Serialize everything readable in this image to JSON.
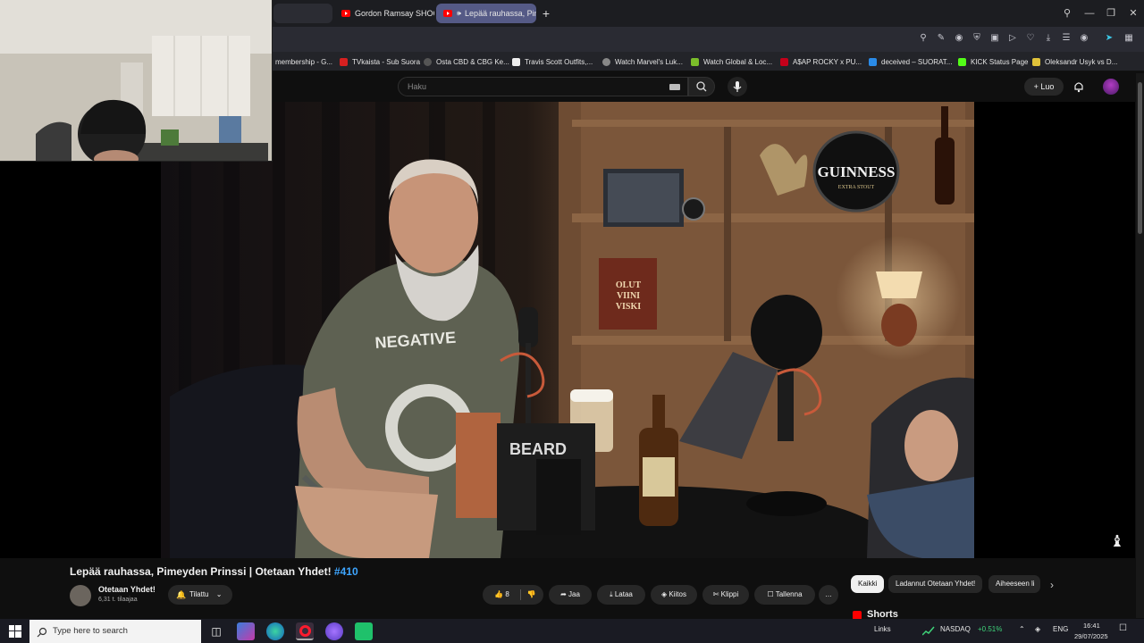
{
  "browser": {
    "tabs": [
      {
        "label": "Gordon Ramsay SHOCKE",
        "active": false
      },
      {
        "label": "Lepää rauhassa, Pime",
        "active": true
      }
    ],
    "new_tab": "+",
    "bookmarks": [
      {
        "label": "membership - G...",
        "color": "#2c2c2c"
      },
      {
        "label": "TVkaista - Sub Suora",
        "color": "#d62020"
      },
      {
        "label": "Osta CBD & CBG Ke...",
        "color": "#555555"
      },
      {
        "label": "Travis Scott Outfits,...",
        "color": "#eeeeee"
      },
      {
        "label": "Watch Marvel's Luk...",
        "color": "#888888"
      },
      {
        "label": "Watch Global & Loc...",
        "color": "#7bbd2a"
      },
      {
        "label": "A$AP ROCKY x PU...",
        "color": "#c4001a"
      },
      {
        "label": "deceived – SUORAT...",
        "color": "#2a8be8"
      },
      {
        "label": "KICK Status Page",
        "color": "#53fc18"
      },
      {
        "label": "Oleksandr Usyk vs D...",
        "color": "#e0c23a"
      }
    ]
  },
  "masthead": {
    "search_placeholder": "Haku",
    "create_label": "Luo"
  },
  "video": {
    "title": "Lepää rauhassa, Pimeyden Prinssi | Otetaan Yhdet!",
    "hashtag": "#410",
    "channel_name": "Otetaan Yhdet!",
    "subscribers": "6,31 t. tilaajaa",
    "subscribed_label": "Tilattu",
    "likes": "8",
    "share_label": "Jaa",
    "download_label": "Lataa",
    "thanks_label": "Kiitos",
    "clip_label": "Klippi",
    "save_label": "Tallenna",
    "more_label": "…"
  },
  "scene_text": {
    "shirt": "NEGATIVE",
    "guinness": "GUINNESS",
    "guinness_sub": "EXTRA STOUT",
    "book": [
      "OLUT",
      "VIINI",
      "VISKI"
    ],
    "box": "BEARD"
  },
  "sidebar": {
    "chips": [
      "Kaikki",
      "Ladannut Otetaan Yhdet!",
      "Aiheeseen li"
    ],
    "shorts_label": "Shorts"
  },
  "taskbar": {
    "search_placeholder": "Type here to search",
    "nasdaq_label": "NASDAQ",
    "nasdaq_change": "+0.51%",
    "links_label": "Links",
    "language": "ENG",
    "time": "16:41",
    "date": "29/07/2025"
  },
  "colors": {
    "accent_red": "#ff0000",
    "link_blue": "#3ea6ff",
    "nasdaq_green": "#3fd47a"
  }
}
